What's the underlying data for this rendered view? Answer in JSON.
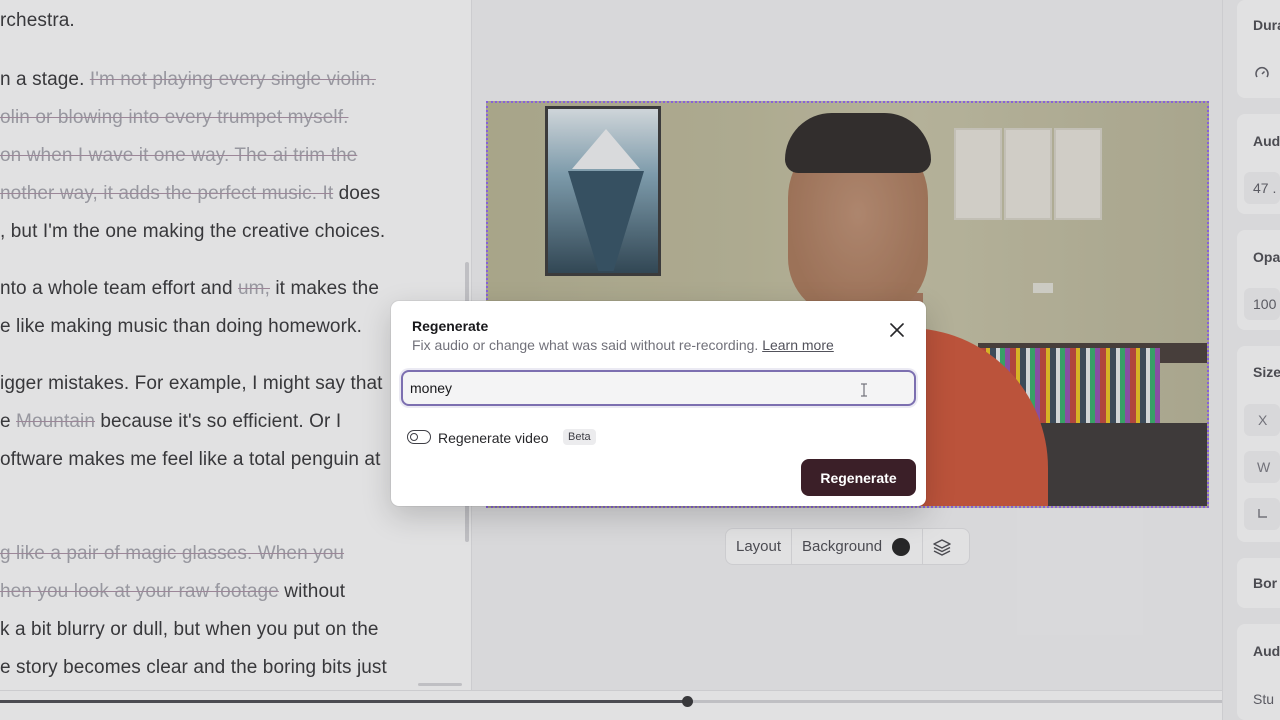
{
  "transcript": {
    "lines": [
      [
        {
          "text": "rchestra.",
          "strike": false
        }
      ],
      [
        {
          "text": "n a stage. ",
          "strike": false
        },
        {
          "text": "I'm not playing every single violin.",
          "strike": true
        }
      ],
      [
        {
          "text": "olin or blowing into every trumpet myself.",
          "strike": true
        }
      ],
      [
        {
          "text": "on when I wave it one way. The ai trim the",
          "strike": true
        }
      ],
      [
        {
          "text": "nother way, it adds the perfect music. It",
          "strike": true
        },
        {
          "text": " does",
          "strike": false
        }
      ],
      [
        {
          "text": ", but I'm the one making the creative choices.",
          "strike": false
        }
      ],
      [
        {
          "text": "nto a whole team effort and ",
          "strike": false
        },
        {
          "text": "um,",
          "strike": true
        },
        {
          "text": " it makes the",
          "strike": false
        }
      ],
      [
        {
          "text": "e like making music than doing homework.",
          "strike": false
        }
      ],
      [
        {
          "text": "igger mistakes. For example, I might say that",
          "strike": false
        }
      ],
      [
        {
          "text": "e ",
          "strike": false
        },
        {
          "text": "Mountain",
          "strike": true
        },
        {
          "text": " because it's so efficient. Or I",
          "strike": false
        }
      ],
      [
        {
          "text": "oftware makes me feel like a total penguin at",
          "strike": false
        }
      ],
      [
        {
          "text": "g like a pair of magic glasses. When you",
          "strike": true
        }
      ],
      [
        {
          "text": "hen you look at your raw footage",
          "strike": true
        },
        {
          "text": " without",
          "strike": false
        }
      ],
      [
        {
          "text": "k a bit blurry or dull, but when you put on the",
          "strike": false
        }
      ],
      [
        {
          "text": "e story becomes clear and the boring bits just",
          "strike": false
        }
      ]
    ]
  },
  "toolbar": {
    "layout_label": "Layout",
    "background_label": "Background",
    "background_color": "#111111"
  },
  "properties": {
    "duration_label": "Dura",
    "audio_label": "Aud",
    "audio_value": "47 .",
    "opacity_label": "Opa",
    "opacity_value": "100",
    "size_label": "Size",
    "x_label": "X",
    "w_label": "W",
    "border_label": "Bor",
    "audio2_label": "Aud",
    "studio_label": "Stu"
  },
  "timeline": {
    "progress": 0.5623
  },
  "modal": {
    "title": "Regenerate",
    "subtitle": "Fix audio or change what was said without re-recording.",
    "learn_more": "Learn more",
    "input_value": "money",
    "toggle_label": "Regenerate video",
    "toggle_on": false,
    "beta_badge": "Beta",
    "submit_label": "Regenerate"
  },
  "colors": {
    "accent": "#7c6fb0",
    "primary_button": "#3b1f28",
    "selection_border": "#8b5cf6"
  }
}
